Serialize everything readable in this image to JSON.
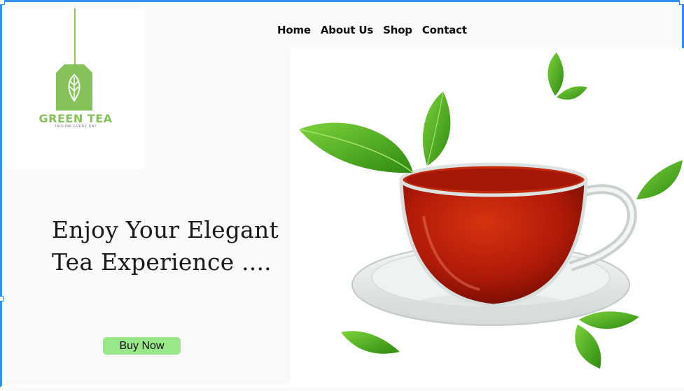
{
  "brand": {
    "name": "GREEN TEA",
    "tagline": "TAGLINE EVERY DAY"
  },
  "nav": {
    "items": [
      {
        "label": "Home"
      },
      {
        "label": "About Us"
      },
      {
        "label": "Shop"
      },
      {
        "label": "Contact"
      }
    ]
  },
  "hero": {
    "title_line1": "Enjoy Your Elegant",
    "title_line2": "Tea Experience ....",
    "cta_label": "Buy Now",
    "image_icon": "tea-cup-with-leaves"
  },
  "colors": {
    "accent_green": "#86c25a",
    "button_green": "#98e88a",
    "tea_red": "#b51f0d",
    "leaf_green": "#4ea51a",
    "selection_blue": "#2f8ff0"
  }
}
